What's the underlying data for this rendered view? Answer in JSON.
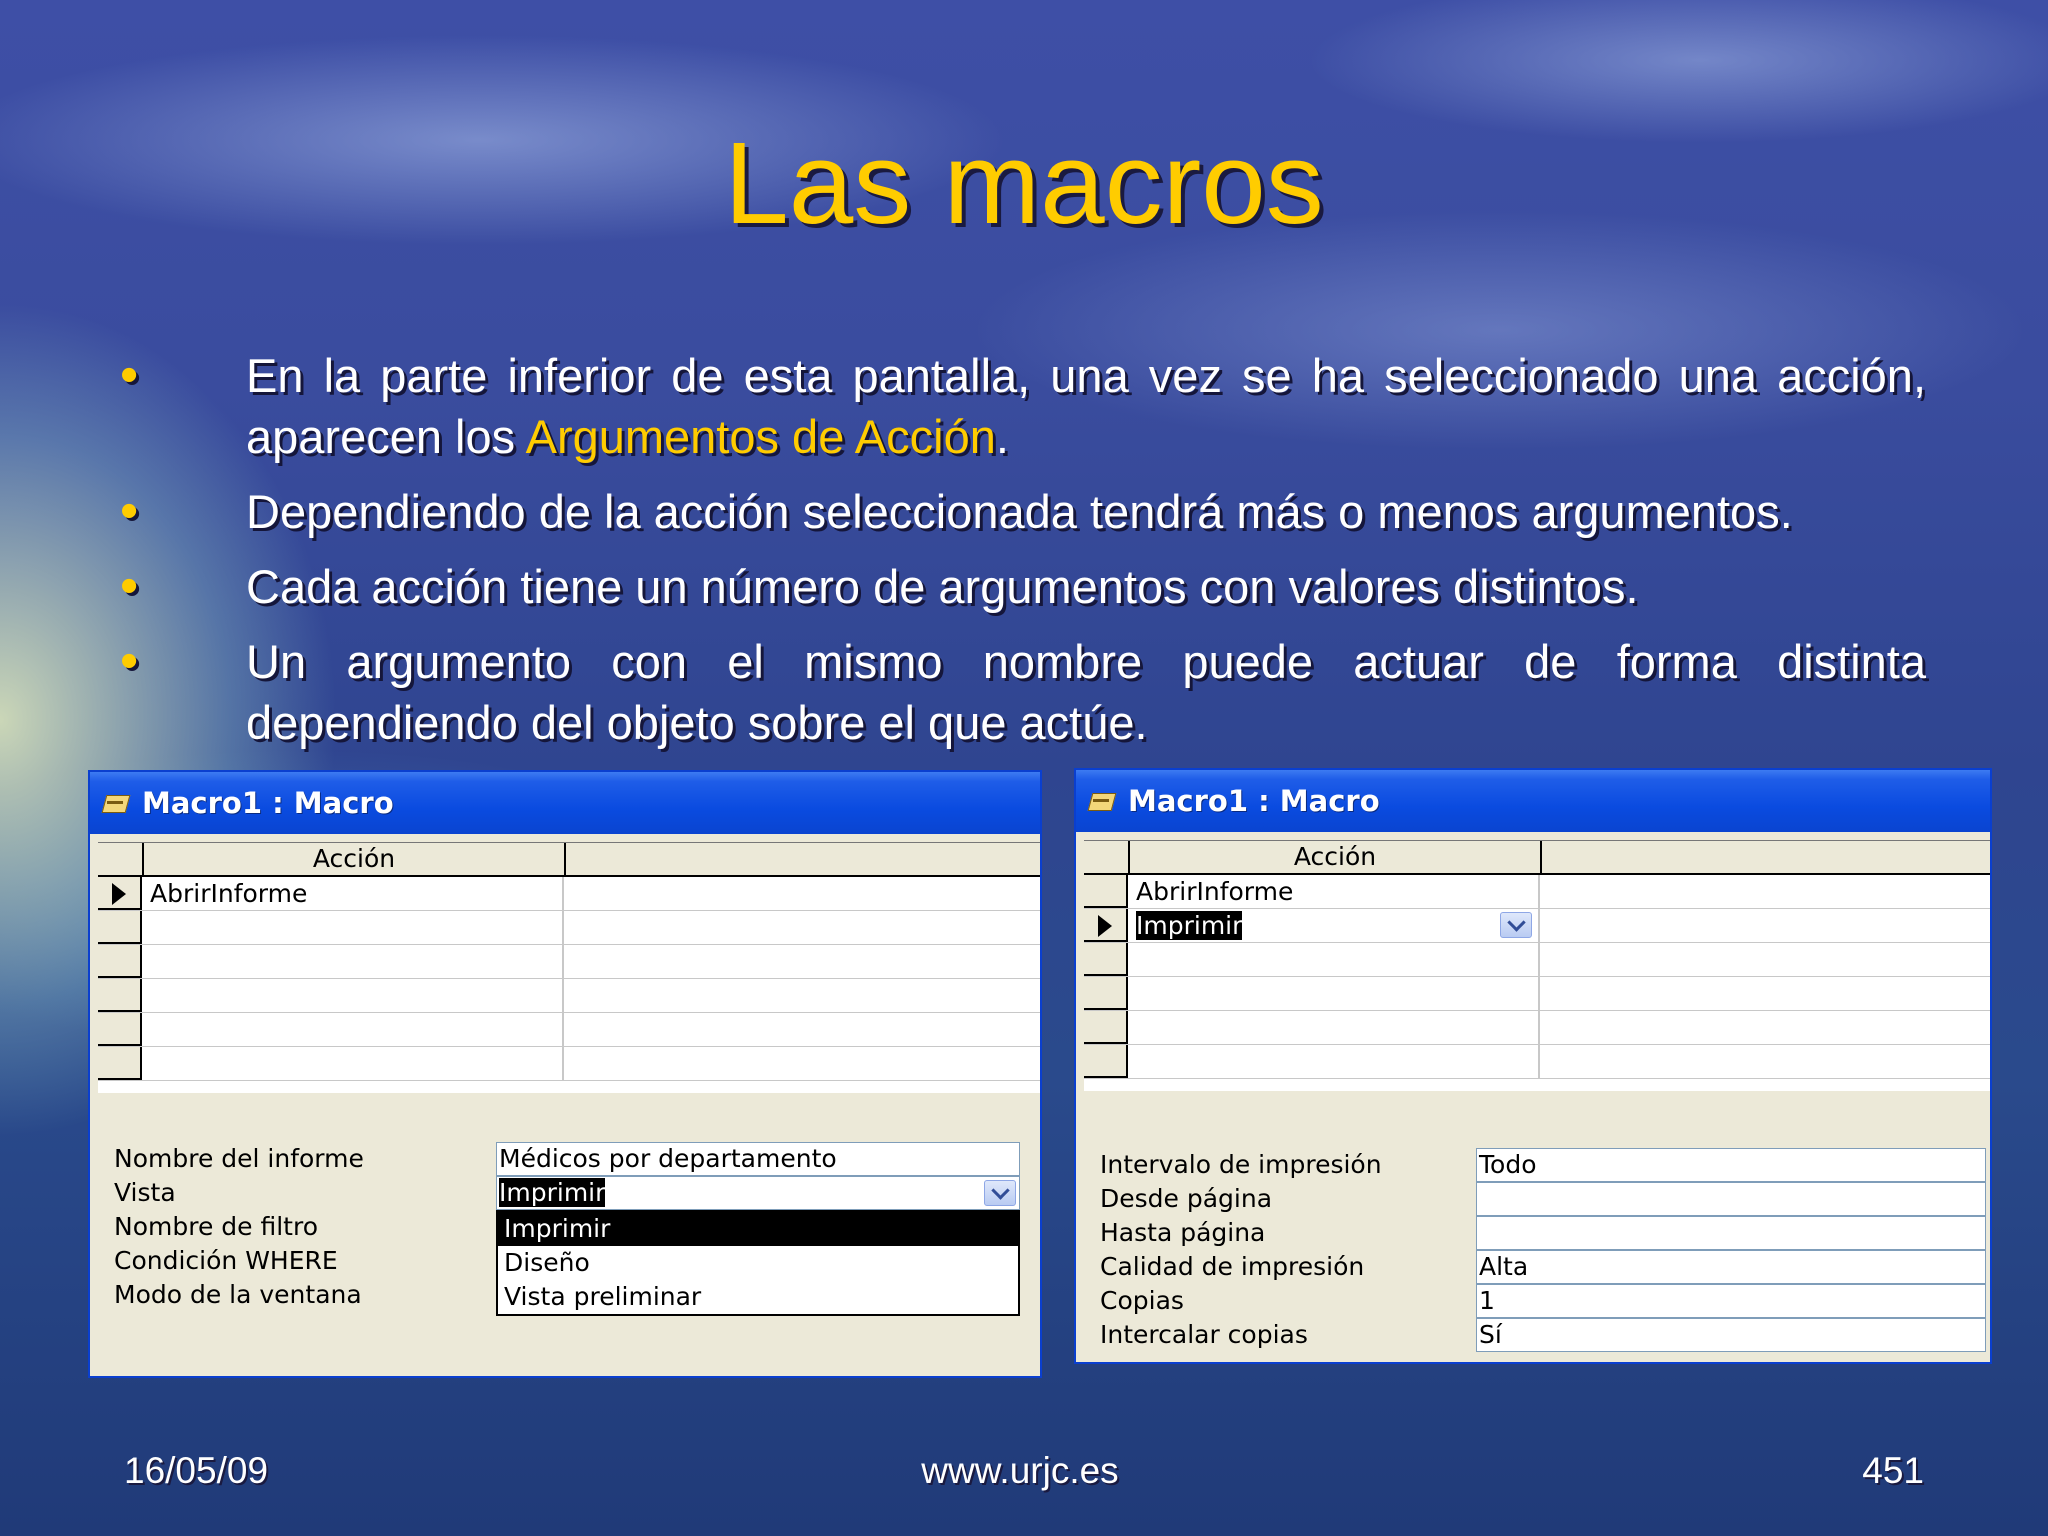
{
  "slide": {
    "title": "Las macros",
    "bullets": [
      {
        "pre": "En la parte inferior de esta pantalla, una vez se ha seleccionado una acción, aparecen los ",
        "highlight": "Argumentos de Acción",
        "post": "."
      },
      {
        "pre": "Dependiendo de la acción seleccionada tendrá más o menos argumentos.",
        "highlight": "",
        "post": ""
      },
      {
        "pre": "Cada acción tiene un número de argumentos con valores distintos.",
        "highlight": "",
        "post": ""
      },
      {
        "pre": "Un argumento con el mismo nombre puede actuar de forma distinta dependiendo del objeto sobre el que actúe.",
        "highlight": "",
        "post": ""
      }
    ],
    "accent_color": "#ffcc00"
  },
  "left_window": {
    "title": "Macro1 : Macro",
    "column_header": "Acción",
    "rows": [
      "AbrirInforme",
      "",
      "",
      "",
      "",
      ""
    ],
    "arguments": [
      {
        "label": "Nombre del informe",
        "value": "Médicos por departamento"
      },
      {
        "label": "Vista",
        "value": "Imprimir"
      },
      {
        "label": "Nombre de filtro",
        "value": ""
      },
      {
        "label": "Condición WHERE",
        "value": ""
      },
      {
        "label": "Modo de la ventana",
        "value": ""
      }
    ],
    "dropdown_options": [
      "Imprimir",
      "Diseño",
      "Vista preliminar"
    ],
    "dropdown_selected": "Imprimir"
  },
  "right_window": {
    "title": "Macro1 : Macro",
    "column_header": "Acción",
    "rows": [
      "AbrirInforme",
      "Imprimir",
      "",
      "",
      "",
      ""
    ],
    "arguments": [
      {
        "label": "Intervalo de impresión",
        "value": "Todo"
      },
      {
        "label": "Desde página",
        "value": ""
      },
      {
        "label": "Hasta página",
        "value": ""
      },
      {
        "label": "Calidad de impresión",
        "value": "Alta"
      },
      {
        "label": "Copias",
        "value": "1"
      },
      {
        "label": "Intercalar copias",
        "value": "Sí"
      }
    ]
  },
  "footer": {
    "date": "16/05/09",
    "url": "www.urjc.es",
    "page": "451"
  },
  "icons": [
    "macro-window-icon",
    "record-selector-arrow-icon",
    "chevron-down-icon"
  ]
}
